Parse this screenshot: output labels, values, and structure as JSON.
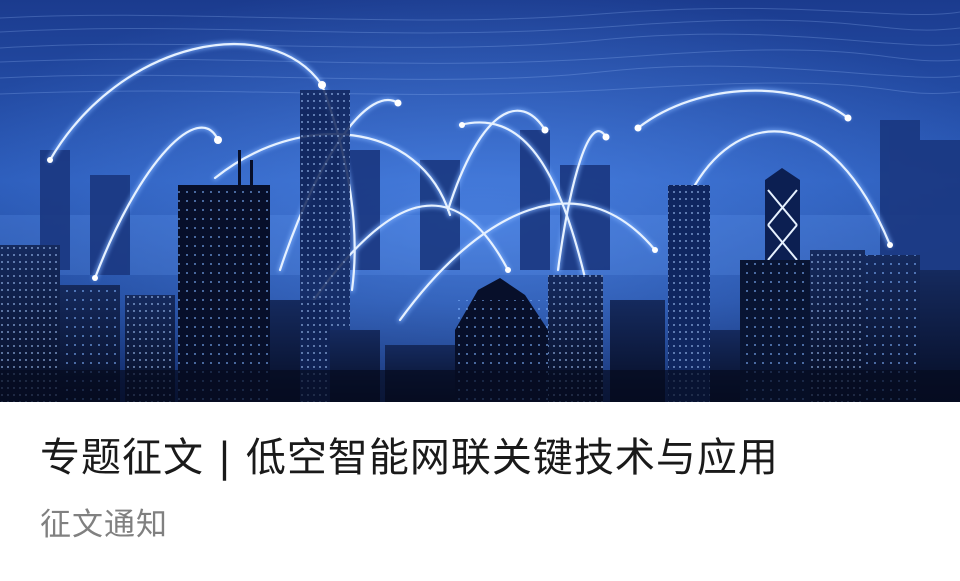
{
  "article": {
    "title": "专题征文 | 低空智能网联关键技术与应用",
    "subtitle": "征文通知"
  },
  "cover": {
    "image": "city-network-skyline",
    "colors": {
      "sky_top": "#1b3b8e",
      "sky_mid": "#2a5ab8",
      "sky_bottom": "#0b1f58",
      "arc": "#dfeeff",
      "building": "#0a1430"
    }
  }
}
